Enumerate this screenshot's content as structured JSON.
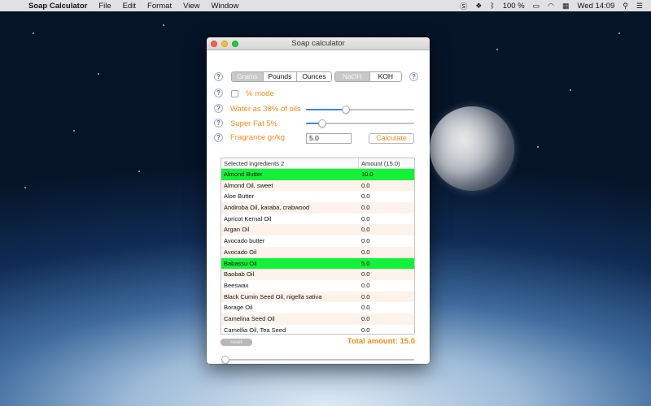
{
  "menubar": {
    "apple": "",
    "app_name": "Soap Calculator",
    "menus": [
      "File",
      "Edit",
      "Format",
      "View",
      "Window"
    ],
    "battery": "100 %",
    "datetime": "Wed 14:09"
  },
  "window": {
    "title": "Soap calculator",
    "units": [
      "Grams",
      "Pounds",
      "Ounces"
    ],
    "selected_unit": "Grams",
    "lye": [
      "NaOH",
      "KOH"
    ],
    "selected_lye": "NaOH",
    "percent_mode_label": "% mode",
    "water_label": "Water as 38% of oils",
    "water_value_fraction": 0.37,
    "superfat_label": "Super Fat 5%",
    "superfat_value_fraction": 0.15,
    "fragrance_label": "Fragrance gr/kg",
    "fragrance_value": "5.0",
    "calculate_label": "Calculate",
    "help_glyph": "?",
    "table": {
      "header_name": "Selected ingredients 2",
      "header_amount": "Amount (15.0)",
      "rows": [
        {
          "name": "Almond Butter",
          "amount": "10.0",
          "selected": true
        },
        {
          "name": "Almond Oil, sweet",
          "amount": "0.0",
          "selected": false
        },
        {
          "name": "Aloe Butter",
          "amount": "0.0",
          "selected": false
        },
        {
          "name": "Andiroba Oil, karaba, crabwood",
          "amount": "0.0",
          "selected": false
        },
        {
          "name": "Apricot Kernal Oil",
          "amount": "0.0",
          "selected": false
        },
        {
          "name": "Argan Oil",
          "amount": "0.0",
          "selected": false
        },
        {
          "name": "Avocado butter",
          "amount": "0.0",
          "selected": false
        },
        {
          "name": "Avocado Oil",
          "amount": "0.0",
          "selected": false
        },
        {
          "name": "Babassu Oil",
          "amount": "5.0",
          "selected": true
        },
        {
          "name": "Baobab Oil",
          "amount": "0.0",
          "selected": false
        },
        {
          "name": "Beeswax",
          "amount": "0.0",
          "selected": false
        },
        {
          "name": "Black Cumin Seed Oil, nigella sativa",
          "amount": "0.0",
          "selected": false
        },
        {
          "name": "Borage Oil",
          "amount": "0.0",
          "selected": false
        },
        {
          "name": "Camelina Seed Oil",
          "amount": "0.0",
          "selected": false
        },
        {
          "name": "Camellia Oil, Tea Seed",
          "amount": "0.0",
          "selected": false
        }
      ]
    },
    "reset_label": "reset",
    "total_label": "Total amount: 15.0",
    "bottom_slider_fraction": 0.0
  },
  "colors": {
    "accent_orange": "#f18c1c",
    "selected_row": "#13f239",
    "alt_row": "#fdf3ea"
  }
}
